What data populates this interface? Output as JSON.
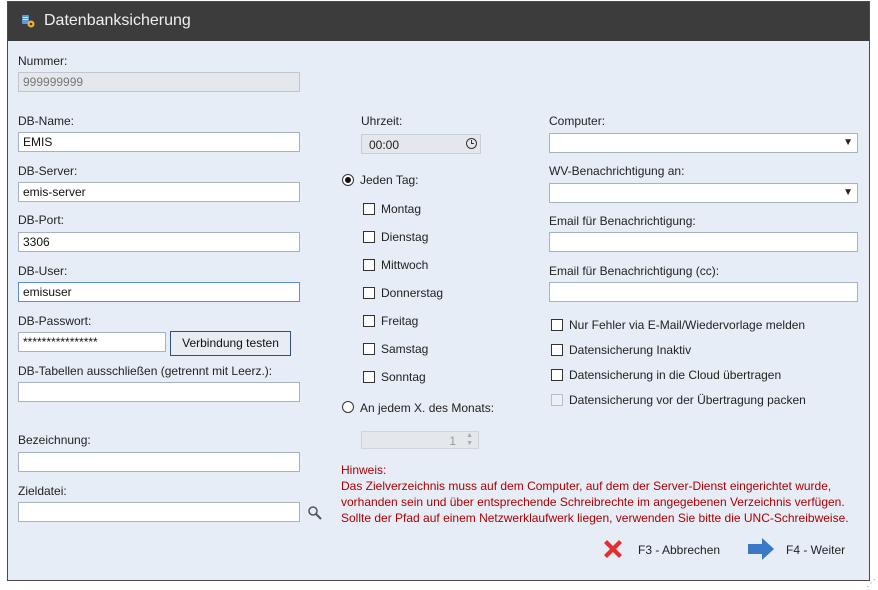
{
  "window": {
    "title": "Datenbanksicherung"
  },
  "left": {
    "nummer_label": "Nummer:",
    "nummer_value": "999999999",
    "dbname_label": "DB-Name:",
    "dbname_value": "EMIS",
    "dbserver_label": "DB-Server:",
    "dbserver_value": "emis-server",
    "dbport_label": "DB-Port:",
    "dbport_value": "3306",
    "dbuser_label": "DB-User:",
    "dbuser_value": "emisuser",
    "dbpass_label": "DB-Passwort:",
    "dbpass_value": "****************",
    "test_button": "Verbindung testen",
    "exclude_label": "DB-Tabellen ausschließen (getrennt mit Leerz.):",
    "exclude_value": "",
    "bezeichnung_label": "Bezeichnung:",
    "bezeichnung_value": "",
    "zieldatei_label": "Zieldatei:",
    "zieldatei_value": ""
  },
  "middle": {
    "uhrzeit_label": "Uhrzeit:",
    "uhrzeit_value": "00:00",
    "jeden_tag_label": "Jeden Tag:",
    "days": [
      "Montag",
      "Dienstag",
      "Mittwoch",
      "Donnerstag",
      "Freitag",
      "Samstag",
      "Sonntag"
    ],
    "monat_label": "An jedem X. des Monats:",
    "monat_value": "1"
  },
  "right": {
    "computer_label": "Computer:",
    "wv_label": "WV-Benachrichtigung an:",
    "email_label": "Email für Benachrichtigung:",
    "email_cc_label": "Email für Benachrichtigung (cc):",
    "options": [
      "Nur Fehler via E-Mail/Wiedervorlage melden",
      "Datensicherung Inaktiv",
      "Datensicherung in die Cloud übertragen",
      "Datensicherung vor der Übertragung packen"
    ]
  },
  "hint": {
    "title": "Hinweis:",
    "lines": [
      "Das Zielverzeichnis muss auf dem Computer, auf dem der Server-Dienst eingerichtet wurde,",
      "vorhanden sein und über entsprechende Schreibrechte im angegebenen Verzeichnis verfügen.",
      "Sollte der Pfad auf einem Netzwerklaufwerk liegen, verwenden Sie bitte die UNC-Schreibweise."
    ]
  },
  "footer": {
    "cancel_label": "F3 - Abbrechen",
    "next_label": "F4 - Weiter"
  },
  "colors": {
    "titlebar": "#3c3c3c",
    "background": "#e6edf6",
    "hint": "#b00000",
    "cancel_icon": "#e03030",
    "next_icon": "#3a78c8"
  }
}
